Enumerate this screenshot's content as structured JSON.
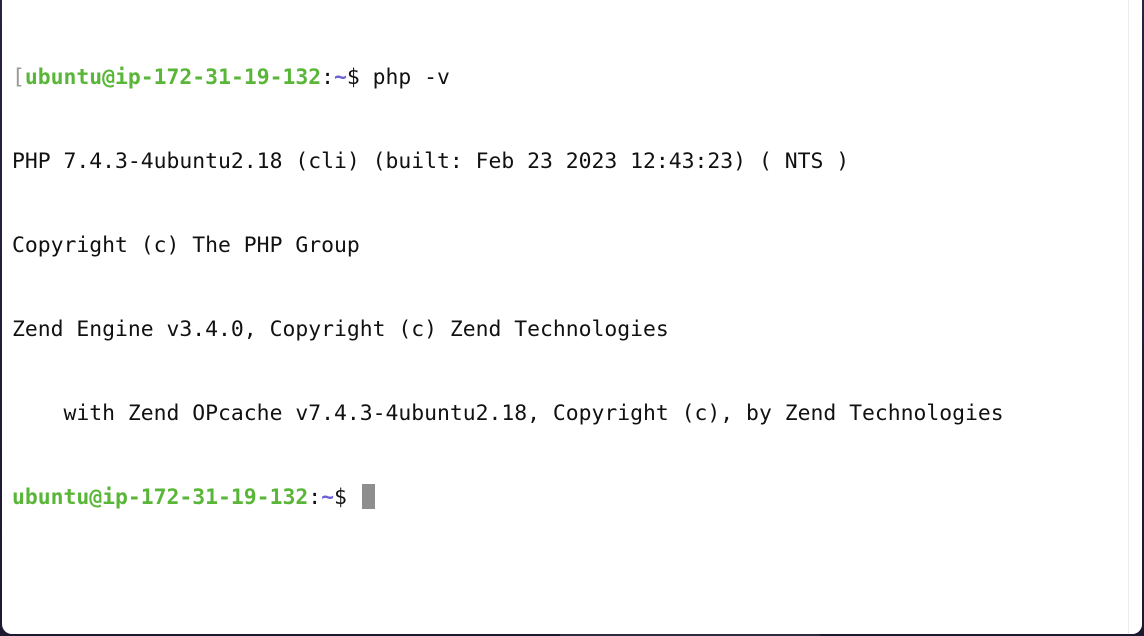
{
  "terminal": {
    "prompt": {
      "user_host": "ubuntu@ip-172-31-19-132",
      "separator": ":",
      "path": "~",
      "dollar": "$"
    },
    "command": " php -v",
    "output_lines": [
      "PHP 7.4.3-4ubuntu2.18 (cli) (built: Feb 23 2023 12:43:23) ( NTS )",
      "Copyright (c) The PHP Group",
      "Zend Engine v3.4.0, Copyright (c) Zend Technologies",
      "    with Zend OPcache v7.4.3-4ubuntu2.18, Copyright (c), by Zend Technologies"
    ],
    "bracket": "["
  },
  "colors": {
    "prompt_user": "#5ab638",
    "prompt_path": "#6a61d6",
    "text": "#111111",
    "cursor": "#8e8e8e",
    "background": "#ffffff"
  },
  "icons": {
    "cursor": "block-cursor"
  }
}
